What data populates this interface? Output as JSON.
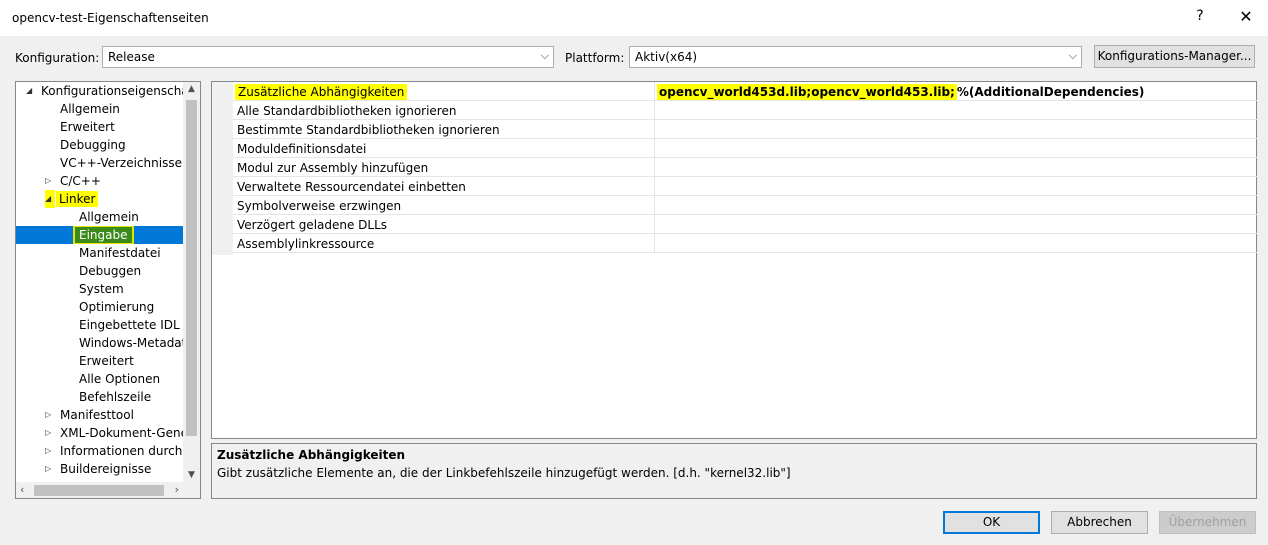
{
  "window": {
    "title": "opencv-test-Eigenschaftenseiten",
    "help": "?",
    "close": "✕"
  },
  "toolbar": {
    "config_label": "Konfiguration:",
    "config_value": "Release",
    "platform_label": "Plattform:",
    "platform_value": "Aktiv(x64)",
    "manager_button": "Konfigurations-Manager..."
  },
  "tree": {
    "root": "Konfigurationseigenschaften",
    "items": [
      "Allgemein",
      "Erweitert",
      "Debugging",
      "VC++-Verzeichnisse",
      "C/C++",
      "Linker",
      "Allgemein",
      "Eingabe",
      "Manifestdatei",
      "Debuggen",
      "System",
      "Optimierung",
      "Eingebettete IDL",
      "Windows-Metadaten",
      "Erweitert",
      "Alle Optionen",
      "Befehlszeile",
      "Manifesttool",
      "XML-Dokument-Generator",
      "Informationen durchsuchen",
      "Buildereignisse"
    ]
  },
  "properties": [
    {
      "name": "Zusätzliche Abhängigkeiten",
      "value_highlighted": "opencv_world453d.lib;opencv_world453.lib;",
      "value_rest": "%(AdditionalDependencies)"
    },
    {
      "name": "Alle Standardbibliotheken ignorieren"
    },
    {
      "name": "Bestimmte Standardbibliotheken ignorieren"
    },
    {
      "name": "Moduldefinitionsdatei"
    },
    {
      "name": "Modul zur Assembly hinzufügen"
    },
    {
      "name": "Verwaltete Ressourcendatei einbetten"
    },
    {
      "name": "Symbolverweise erzwingen"
    },
    {
      "name": "Verzögert geladene DLLs"
    },
    {
      "name": "Assemblylinkressource"
    }
  ],
  "description": {
    "title": "Zusätzliche Abhängigkeiten",
    "text": "Gibt zusätzliche Elemente an, die der Linkbefehlszeile hinzugefügt werden. [d.h. \"kernel32.lib\"]"
  },
  "buttons": {
    "ok": "OK",
    "cancel": "Abbrechen",
    "apply": "Übernehmen"
  },
  "colors": {
    "selection": "#0078d7",
    "highlight": "#ffff00",
    "highlight_green": "#3a8a1a"
  }
}
